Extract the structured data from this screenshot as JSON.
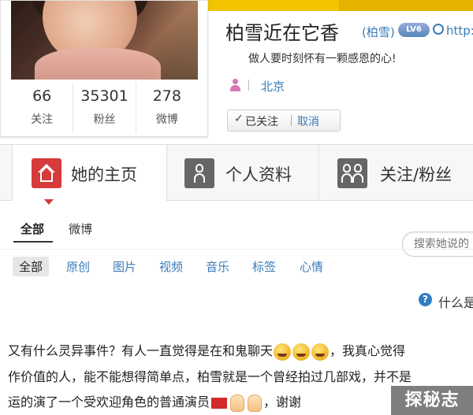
{
  "profile": {
    "name": "柏雪近在它香",
    "alias": "(柏雪)",
    "level_badge": "LV6",
    "url": "http://w",
    "bio": "做人要时刻怀有一颗感恩的心!",
    "city": "北京",
    "followed_label": "已关注",
    "followed_check": "✓",
    "cancel_label": "取消",
    "stats": [
      {
        "value": "66",
        "label": "关注"
      },
      {
        "value": "35301",
        "label": "粉丝"
      },
      {
        "value": "278",
        "label": "微博"
      }
    ]
  },
  "tabs": [
    {
      "label": "她的主页",
      "active": true,
      "icon": "home-icon"
    },
    {
      "label": "个人资料",
      "active": false,
      "icon": "person-icon"
    },
    {
      "label": "关注/粉丝",
      "active": false,
      "icon": "people-icon"
    }
  ],
  "subnav": {
    "all": "全部",
    "weibo": "微博",
    "search_placeholder": "搜索她说的"
  },
  "filters": [
    "全部",
    "原创",
    "图片",
    "视频",
    "音乐",
    "标签",
    "心情"
  ],
  "help": {
    "icon": "?",
    "text": "什么是"
  },
  "post": {
    "line1": "又有什么灵异事件？有人一直觉得是在和鬼聊天",
    "line1_tail": "，我真心觉得",
    "line2": "作价值的人，能不能想得简单点，柏雪就是一个曾经拍过几部戏，并不是",
    "line3": "运的演了一个受欢迎角色的普通演员",
    "line3_tail": "，谢谢"
  },
  "watermark": "探秘志",
  "colors": {
    "accent": "#3a7bb8",
    "home_tab_icon": "#d63a3a",
    "topbar": "#f3c300"
  }
}
